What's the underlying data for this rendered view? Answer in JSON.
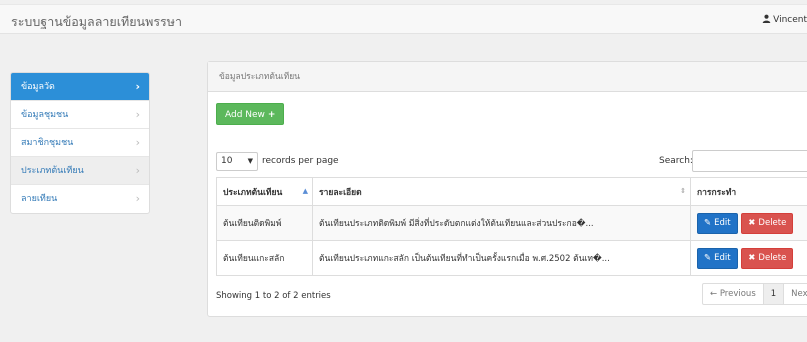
{
  "navbar": {
    "brand": "ระบบฐานข้อมูลลายเทียนพรรษา",
    "user": "Vincent"
  },
  "sidebar": {
    "items": [
      {
        "label": "ข้อมูลวัด",
        "state": "active"
      },
      {
        "label": "ข้อมูลชุมชน",
        "state": ""
      },
      {
        "label": "สมาชิกชุมชน",
        "state": ""
      },
      {
        "label": "ประเภทต้นเทียน",
        "state": "hover"
      },
      {
        "label": "ลายเทียน",
        "state": ""
      }
    ]
  },
  "panel": {
    "heading": "ข้อมูลประเภทต้นเทียน",
    "add_button": "Add New",
    "length": {
      "value": "10",
      "suffix": "records per page"
    },
    "search_label": "Search:",
    "table": {
      "headers": [
        "ประเภทต้นเทียน",
        "รายละเอียด",
        "การกระทำ"
      ],
      "rows": [
        {
          "type": "ต้นเทียนติดพิมพ์",
          "detail": "ต้นเทียนประเภทติดพิมพ์ มีสิ่งที่ประดับตกแต่งให้ต้นเทียนและส่วนประกอ�..."
        },
        {
          "type": "ต้นเทียนแกะสลัก",
          "detail": "ต้นเทียนประเภทแกะสลัก เป็นต้นเทียนที่ทำเป็นครั้งแรกเมื่อ พ.ศ.2502 ต้นเท�..."
        }
      ],
      "edit_label": "Edit",
      "delete_label": "Delete"
    },
    "info": "Showing 1 to 2 of 2 entries",
    "pager": {
      "prev": "← Previous",
      "page": "1",
      "next": "Next"
    }
  },
  "colors": {
    "active": "#2c8fd8",
    "success": "#5cb85c",
    "primary": "#2173c7",
    "danger": "#d9534f"
  }
}
